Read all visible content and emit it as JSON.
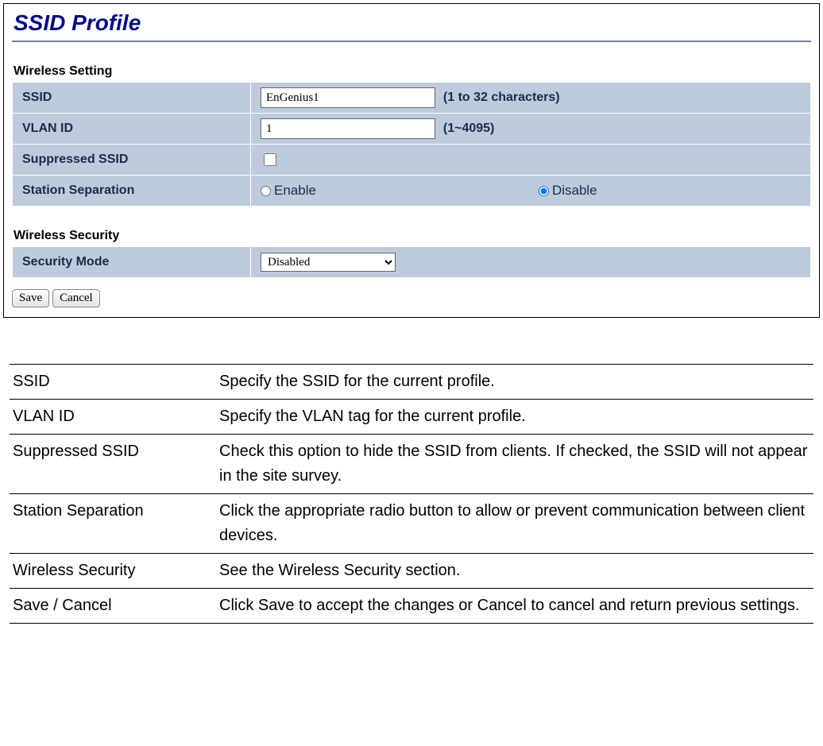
{
  "page_title": "SSID Profile",
  "wireless_setting": {
    "heading": "Wireless Setting",
    "ssid_label": "SSID",
    "ssid_value": "EnGenius1",
    "ssid_hint": "(1 to 32 characters)",
    "vlan_label": "VLAN ID",
    "vlan_value": "1",
    "vlan_hint": "(1~4095)",
    "suppressed_label": "Suppressed SSID",
    "suppressed_checked": false,
    "station_sep_label": "Station Separation",
    "station_sep_enable": "Enable",
    "station_sep_disable": "Disable",
    "station_sep_selected": "disable"
  },
  "wireless_security": {
    "heading": "Wireless Security",
    "mode_label": "Security Mode",
    "mode_value": "Disabled",
    "mode_options": [
      "Disabled"
    ]
  },
  "buttons": {
    "save": "Save",
    "cancel": "Cancel"
  },
  "descriptions": [
    {
      "term": "SSID",
      "desc": "Specify the SSID for the current profile."
    },
    {
      "term": "VLAN ID",
      "desc": "Specify the VLAN tag for the current profile."
    },
    {
      "term": "Suppressed SSID",
      "desc": "Check this option to hide the SSID from clients. If checked, the SSID will not appear in the site survey."
    },
    {
      "term": "Station Separation",
      "desc": "Click the appropriate radio button to allow or prevent communication between client devices."
    },
    {
      "term": "Wireless Security",
      "desc": "See the Wireless Security section."
    },
    {
      "term": "Save / Cancel",
      "desc": "Click Save to accept the changes or Cancel to cancel and return previous settings."
    }
  ]
}
